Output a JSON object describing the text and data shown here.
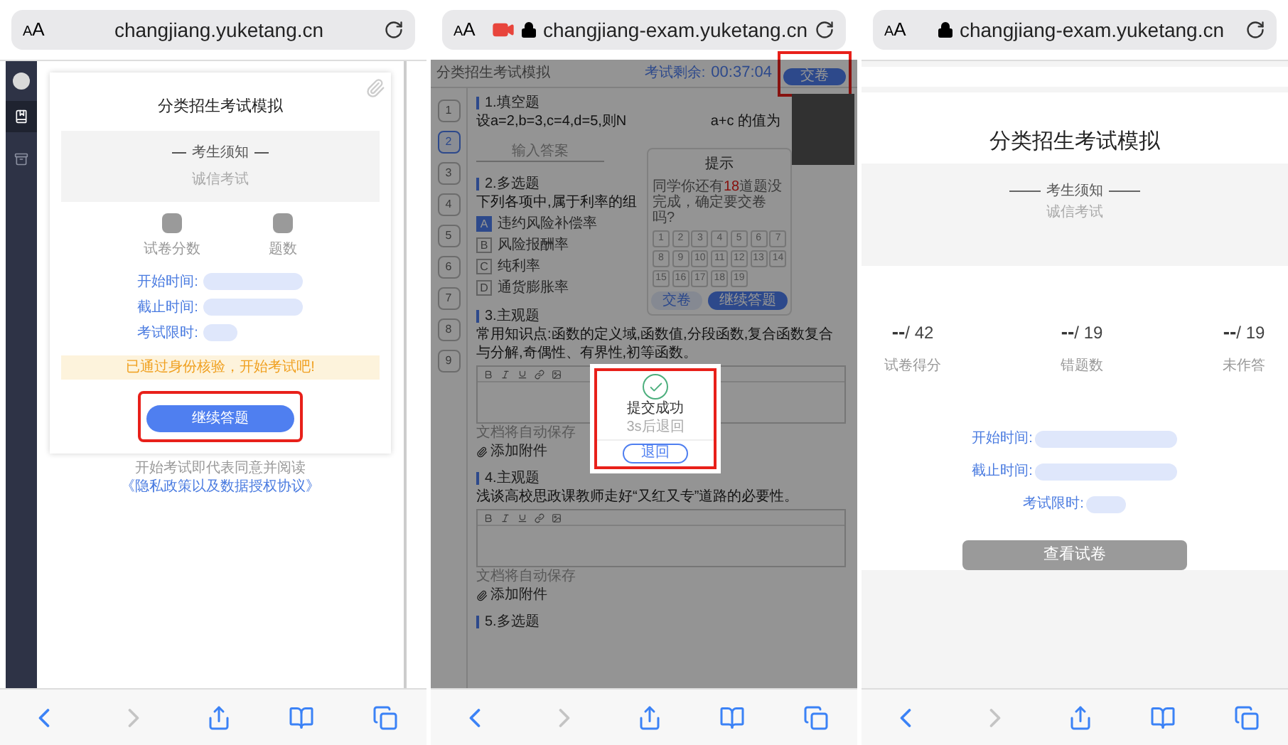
{
  "start_screen": {
    "browser": {
      "text_size": "AA",
      "url": "changjiang.yuketang.cn"
    },
    "sidebar": {
      "items": [
        {
          "kind": "book",
          "selected": true
        },
        {
          "kind": "box",
          "selected": false
        }
      ]
    },
    "card": {
      "title": "分类招生考试模拟",
      "notice_heading": "考生须知",
      "notice_text": "诚信考试",
      "stats": [
        {
          "label": "试卷分数"
        },
        {
          "label": "题数"
        }
      ],
      "times": [
        {
          "label": "开始时间:"
        },
        {
          "label": "截止时间:"
        },
        {
          "label": "考试限时:"
        }
      ],
      "banner": "已通过身份核验，开始考试吧!",
      "button": {
        "label": "继续答题",
        "highlighted": true
      }
    },
    "footer": {
      "text": "开始考试即代表同意并阅读",
      "link": "《隐私政策以及数据授权协议》"
    },
    "toolbar": {
      "back_enabled": true,
      "forward_enabled": false
    }
  },
  "exam_screen": {
    "browser": {
      "text_size": "AA",
      "url": "changjiang-exam.yuketang.cn",
      "secure": true,
      "recording": true
    },
    "header": {
      "title": "分类招生考试模拟",
      "remaining_label": "考试剩余:",
      "timer": "00:37:04",
      "submit": {
        "label": "交卷",
        "highlighted": true
      }
    },
    "nav": [
      {
        "label": "1",
        "selected": false
      },
      {
        "label": "2",
        "selected": true
      },
      {
        "label": "3",
        "selected": false
      },
      {
        "label": "4",
        "selected": false
      },
      {
        "label": "5",
        "selected": false
      },
      {
        "label": "6",
        "selected": false
      },
      {
        "label": "7",
        "selected": false
      },
      {
        "label": "8",
        "selected": false
      },
      {
        "label": "9",
        "selected": false
      }
    ],
    "questions": [
      {
        "kind": "fill",
        "title": "1.填空题",
        "stem": "设a=2,b=3,c=4,d=5,则N",
        "stem_end": "a+c 的值为",
        "placeholder": "输入答案"
      },
      {
        "kind": "choice",
        "title": "2.多选题",
        "stem": "下列各项中,属于利率的组",
        "options": [
          {
            "letter": "A",
            "text": "违约风险补偿率",
            "selected": true
          },
          {
            "letter": "B",
            "text": "风险报酬率",
            "selected": false
          },
          {
            "letter": "C",
            "text": "纯利率",
            "selected": false
          },
          {
            "letter": "D",
            "text": "通货膨胀率",
            "selected": false
          }
        ]
      },
      {
        "kind": "essay",
        "title": "3.主观题",
        "stem": "常用知识点:函数的定义域,函数值,分段函数,复合函数复合与分解,奇偶性、有界性,初等函数。",
        "autosave": "文档将自动保存",
        "attach": "添加附件"
      },
      {
        "kind": "essay",
        "title": "4.主观题",
        "stem": "浅谈高校思政课教师走好“又红又专”道路的必要性。",
        "autosave": "文档将自动保存",
        "attach": "添加附件"
      },
      {
        "kind": "heading",
        "title": "5.多选题"
      }
    ],
    "confirm_dialog": {
      "title": "提示",
      "message_start": "同学你还有",
      "count": "18",
      "message_end": "道题没完成，确定要交卷吗?",
      "numbers": [
        "1",
        "2",
        "3",
        "4",
        "5",
        "6",
        "7",
        "8",
        "9",
        "10",
        "11",
        "12",
        "13",
        "14",
        "15",
        "16",
        "17",
        "18",
        "19"
      ],
      "cancel": "交卷",
      "confirm": "继续答题"
    },
    "success_dialog": {
      "title": "提交成功",
      "subtitle": "3s后退回",
      "button": "退回",
      "highlighted": true
    },
    "toolbar": {
      "back_enabled": true,
      "forward_enabled": false
    }
  },
  "result_screen": {
    "browser": {
      "text_size": "AA",
      "url": "changjiang-exam.yuketang.cn",
      "secure": true
    },
    "title": "分类招生考试模拟",
    "notice_heading": "考生须知",
    "notice_text": "诚信考试",
    "stats": [
      {
        "value": "--",
        "total": "/ 42",
        "label": "试卷得分"
      },
      {
        "value": "--",
        "total": "/ 19",
        "label": "错题数"
      },
      {
        "value": "--",
        "total": "/ 19",
        "label": "未作答"
      }
    ],
    "times": [
      {
        "label": "开始时间:"
      },
      {
        "label": "截止时间:"
      },
      {
        "label": "考试限时:"
      }
    ],
    "button": "查看试卷",
    "toolbar": {
      "back_enabled": true,
      "forward_enabled": false
    }
  }
}
